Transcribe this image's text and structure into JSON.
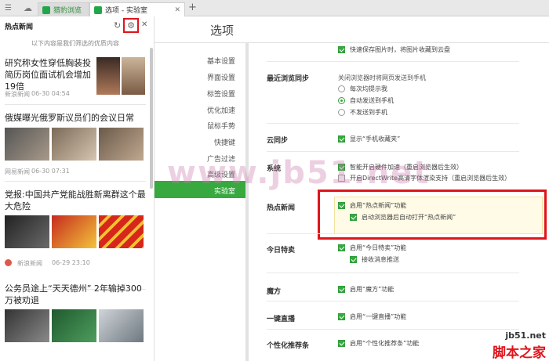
{
  "tabs": [
    {
      "label": "猎豹浏览"
    },
    {
      "label": "选项 - 实验室"
    }
  ],
  "panel": {
    "title": "热点新闻",
    "subtitle": "以下内容是我们筛选的优质内容",
    "news": [
      {
        "title": "研究称女性穿低胸装投简历岗位面试机会增加19倍",
        "source": "新浪新闻",
        "time": "06-30 04:54"
      },
      {
        "title": "俄媒曝光俄罗斯议员们的会议日常",
        "source": "网易新闻",
        "time": "06-30 07:31"
      },
      {
        "title": "党报:中国共产党能战胜新离群这个最大危险",
        "source": "新浪新闻",
        "time": "06-29 23:10"
      },
      {
        "title": "公务员途上“天天德州” 2年输掉300万被劝退"
      }
    ]
  },
  "page_title": "选项",
  "nav": [
    "基本设置",
    "界面设置",
    "标签设置",
    "优化加速",
    "鼠标手势",
    "快捷键",
    "广告过滤",
    "高级设置",
    "实验室"
  ],
  "settings": {
    "top_row": "快速保存图片时，将图片收藏到云盘",
    "sync": {
      "label": "最近浏览同步",
      "desc": "关闭浏览器时将网页发送到手机",
      "opts": [
        "每次均提示我",
        "自动发送到手机",
        "不发送到手机"
      ]
    },
    "cloud": {
      "label": "云同步",
      "opt": "显示“手机收藏夹”"
    },
    "system": {
      "label": "系统",
      "opts": [
        "智能开启硬件加速（重启浏览器后生效）",
        "开启DirectWrite高清字体渲染支持（重启浏览器后生效）"
      ]
    },
    "hotnews": {
      "label": "热点新闻",
      "opts": [
        "启用“热点新闻”功能",
        "启动浏览器后自动打开“热点新闻”"
      ]
    },
    "today": {
      "label": "今日特卖",
      "opts": [
        "启用“今日特卖”功能",
        "接收消息推送"
      ]
    },
    "magic": {
      "label": "魔方",
      "opt": "启用“魔方”功能"
    },
    "live": {
      "label": "一键直播",
      "opt": "启用“一键直播”功能"
    },
    "personal": {
      "label": "个性化推荐条",
      "opt": "启用“个性化推荐条”功能"
    }
  },
  "watermark": {
    "site": "www.jb51.net",
    "brand_site": "jb51.net",
    "brand_name": "脚本之家"
  },
  "colors": {
    "accent_green": "#37a93f",
    "highlight_red": "#e0141b",
    "highlight_bg": "#fffbe6"
  }
}
